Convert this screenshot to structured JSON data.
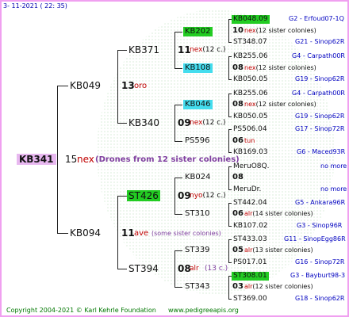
{
  "header": {
    "date": "3- 11-2021 ( 22: 35)"
  },
  "root": {
    "label": "KB341",
    "count": "15",
    "note": "nex",
    "description": "(Drones from 12 sister colonies)"
  },
  "gen1": [
    {
      "label": "KB049",
      "count": "13",
      "note": "oro"
    },
    {
      "label": "KB094",
      "count": "11",
      "note": "ave",
      "description": "(some sister colonies)"
    }
  ],
  "gen2": [
    {
      "label": "KB371",
      "count": "11",
      "note": "nex(12 c.)"
    },
    {
      "label": "KB340",
      "count": "09",
      "note": "nex(12 c.)"
    },
    {
      "label": "ST426",
      "count": "09",
      "note": "nyo(12 c.)"
    },
    {
      "label": "ST394",
      "count": "08",
      "note": "alr",
      "note2": "(13 c.)"
    }
  ],
  "gen3": [
    {
      "label": "KB202",
      "count": "10",
      "note": "nex(12 sister colonies)"
    },
    {
      "label": "KB108",
      "count": "08",
      "note": "nex(12 sister colonies)"
    },
    {
      "label": "KB046",
      "count": "08",
      "note": "nex(12 sister colonies)"
    },
    {
      "label": "PS596",
      "count": "06",
      "note": "tun"
    },
    {
      "label": "KB024",
      "count": "08",
      "note": ""
    },
    {
      "label": "ST310",
      "count": "06",
      "note": "alr(14 sister colonies)"
    },
    {
      "label": "ST339",
      "count": "05",
      "note": "alr(13 sister colonies)"
    },
    {
      "label": "ST343",
      "count": "03",
      "note": "alr(12 sister colonies)"
    }
  ],
  "gen4": [
    {
      "label": "KB048.09",
      "info": "G2 - Erfoud07-1Q"
    },
    {
      "label": "ST348.07",
      "info": "G21 - Sinop62R"
    },
    {
      "label": "KB255.06",
      "info": "G4 - Carpath00R"
    },
    {
      "label": "KB050.05",
      "info": "G19 - Sinop62R"
    },
    {
      "label": "KB255.06",
      "info": "G4 - Carpath00R"
    },
    {
      "label": "KB050.05",
      "info": "G19 - Sinop62R"
    },
    {
      "label": "PS506.04",
      "info": "G17 - Sinop72R"
    },
    {
      "label": "KB169.03",
      "info": "G6 - Maced93R"
    },
    {
      "label": "MeruO8Q.",
      "info": "no more"
    },
    {
      "label": "MeruDr.",
      "info": "no more"
    },
    {
      "label": "ST442.04",
      "info": "G5 - Ankara96R"
    },
    {
      "label": "KB107.02",
      "info": "G3 - Sinop96R"
    },
    {
      "label": "ST433.03",
      "info": "G11 - SinopEgg86R"
    },
    {
      "label": "PS017.01",
      "info": "G16 - Sinop72R"
    },
    {
      "label": "ST308.01",
      "info": "G3 - Bayburt98-3"
    },
    {
      "label": "ST369.00",
      "info": "G18 - Sinop62R"
    }
  ],
  "footer": {
    "copyright": "Copyright 2004-2021 © Karl Kehrle Foundation",
    "url": "www.pedigreeapis.org"
  },
  "colors": {
    "highlight_green": "#22cc22",
    "highlight_cyan": "#44ddee",
    "root_highlight": "#e8b8f0",
    "border": "#f0a0f0"
  }
}
